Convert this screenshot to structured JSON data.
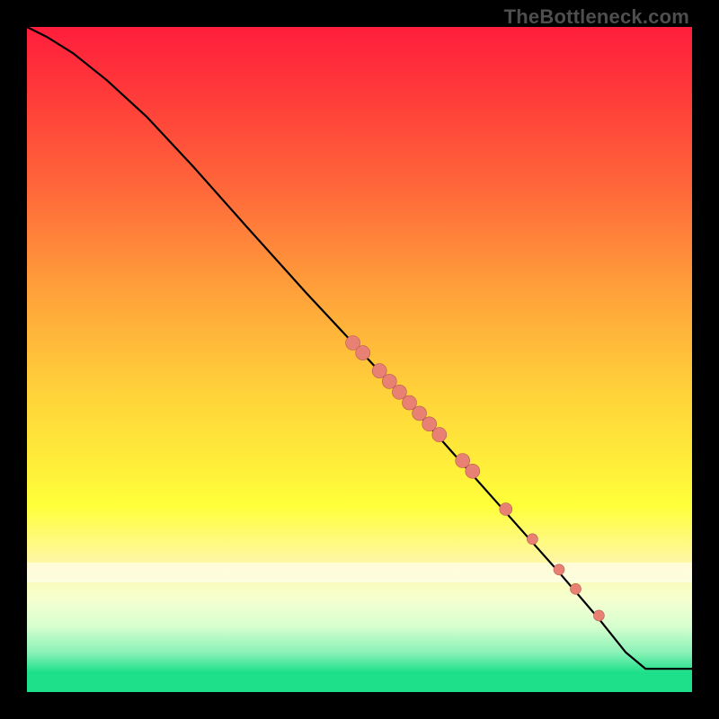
{
  "watermark": "TheBottleneck.com",
  "colors": {
    "marker_fill": "#e88074",
    "marker_stroke": "#b55a50",
    "curve": "#000000"
  },
  "chart_data": {
    "type": "line",
    "title": "",
    "xlabel": "",
    "ylabel": "",
    "xlim": [
      0,
      100
    ],
    "ylim": [
      0,
      100
    ],
    "grid": false,
    "legend": false,
    "curve": [
      {
        "x": 0,
        "y": 100
      },
      {
        "x": 3,
        "y": 98.5
      },
      {
        "x": 7,
        "y": 96
      },
      {
        "x": 12,
        "y": 92
      },
      {
        "x": 18,
        "y": 86.5
      },
      {
        "x": 25,
        "y": 79
      },
      {
        "x": 33,
        "y": 70
      },
      {
        "x": 42,
        "y": 60
      },
      {
        "x": 49,
        "y": 52.5
      },
      {
        "x": 56,
        "y": 45
      },
      {
        "x": 64,
        "y": 36
      },
      {
        "x": 72,
        "y": 27
      },
      {
        "x": 80,
        "y": 18
      },
      {
        "x": 86,
        "y": 11
      },
      {
        "x": 90,
        "y": 6
      },
      {
        "x": 93,
        "y": 3.5
      },
      {
        "x": 95,
        "y": 3.5
      },
      {
        "x": 100,
        "y": 3.5
      }
    ],
    "markers": [
      {
        "x": 49,
        "y": 52.5,
        "r": 8
      },
      {
        "x": 50.5,
        "y": 51,
        "r": 8
      },
      {
        "x": 53,
        "y": 48.3,
        "r": 8
      },
      {
        "x": 54.5,
        "y": 46.7,
        "r": 8
      },
      {
        "x": 56,
        "y": 45.1,
        "r": 8
      },
      {
        "x": 57.5,
        "y": 43.5,
        "r": 8
      },
      {
        "x": 59,
        "y": 41.9,
        "r": 8
      },
      {
        "x": 60.5,
        "y": 40.3,
        "r": 8
      },
      {
        "x": 62,
        "y": 38.7,
        "r": 8
      },
      {
        "x": 65.5,
        "y": 34.8,
        "r": 8
      },
      {
        "x": 67,
        "y": 33.2,
        "r": 8
      },
      {
        "x": 72,
        "y": 27.5,
        "r": 7
      },
      {
        "x": 76,
        "y": 23,
        "r": 6
      },
      {
        "x": 80,
        "y": 18.4,
        "r": 6
      },
      {
        "x": 82.5,
        "y": 15.5,
        "r": 6
      },
      {
        "x": 86,
        "y": 11.5,
        "r": 6
      }
    ]
  }
}
